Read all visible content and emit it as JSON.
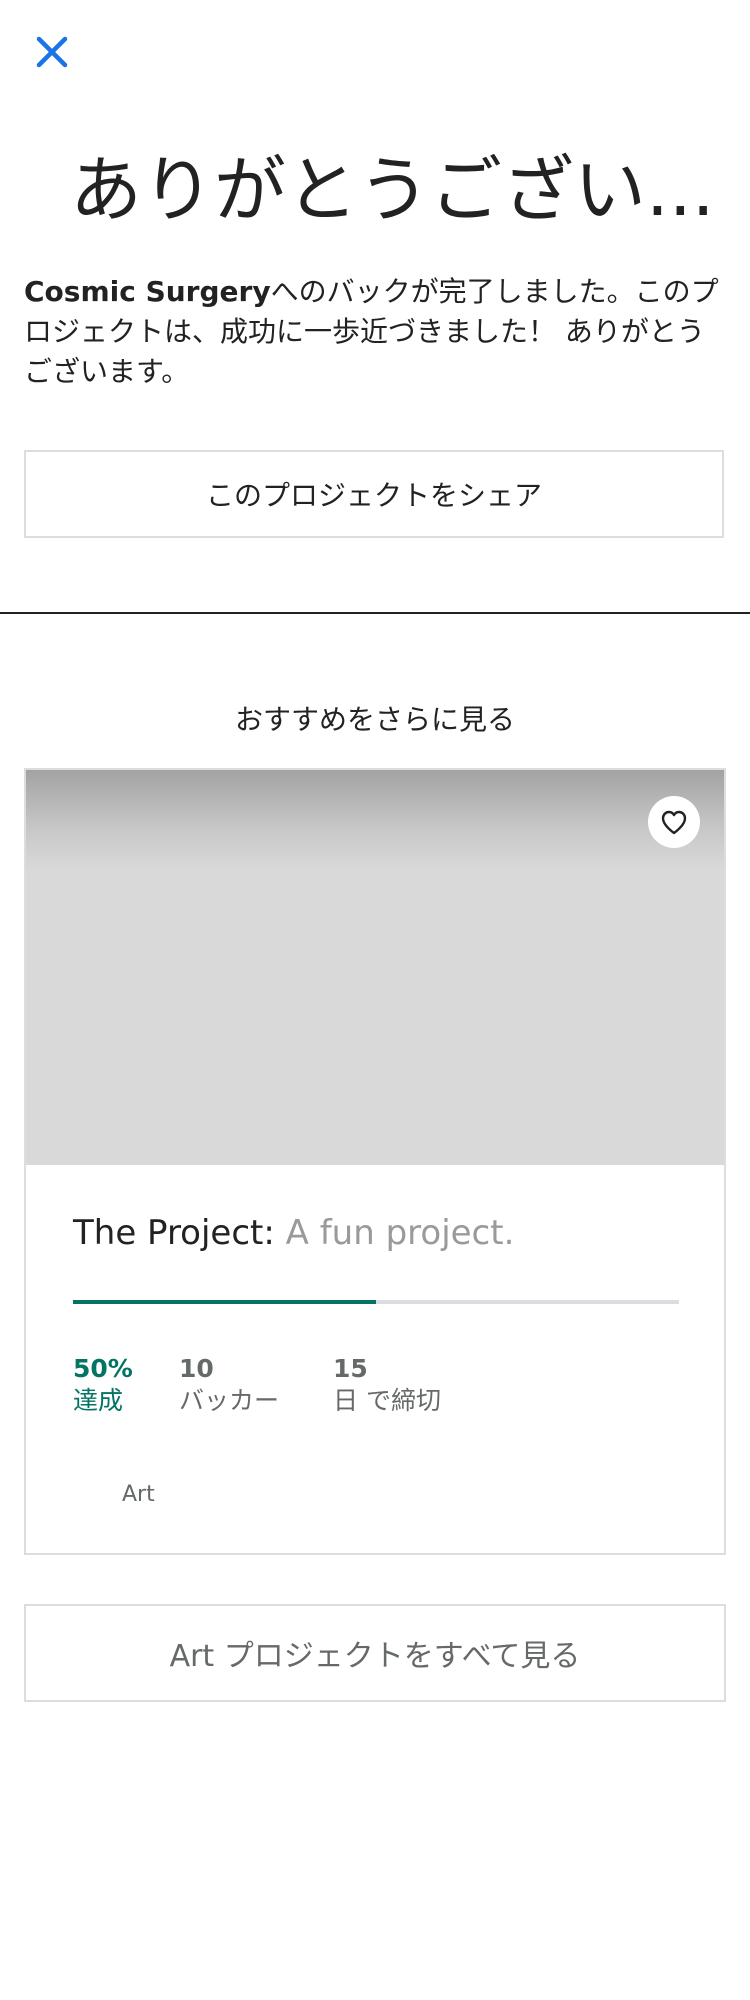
{
  "header": {
    "close_icon": "close-icon",
    "title": "ありがとうござい..."
  },
  "thanks": {
    "project_name": "Cosmic Surgery",
    "message": "へのバックが完了しました。このプロジェクトは、成功に一歩近づきました！ ありがとうございます。",
    "share_label": "このプロジェクトをシェア"
  },
  "recommendations": {
    "heading": "おすすめをさらに見る",
    "card": {
      "save_icon": "heart-icon",
      "name": "The Project:",
      "blurb": "A fun project.",
      "percent_funded": 0.5,
      "stats": {
        "funded_value": "50%",
        "funded_label": "達成",
        "backers_value": "10",
        "backers_label": "バッカー",
        "days_value": "15",
        "days_label": "日 で締切"
      },
      "category": "Art"
    },
    "see_all_label": "Art プロジェクトをすべて見る"
  },
  "colors": {
    "accent_blue": "#1a73e8",
    "funded_green": "#037362",
    "border_gray": "#dcdde2",
    "muted_text": "#656969"
  }
}
